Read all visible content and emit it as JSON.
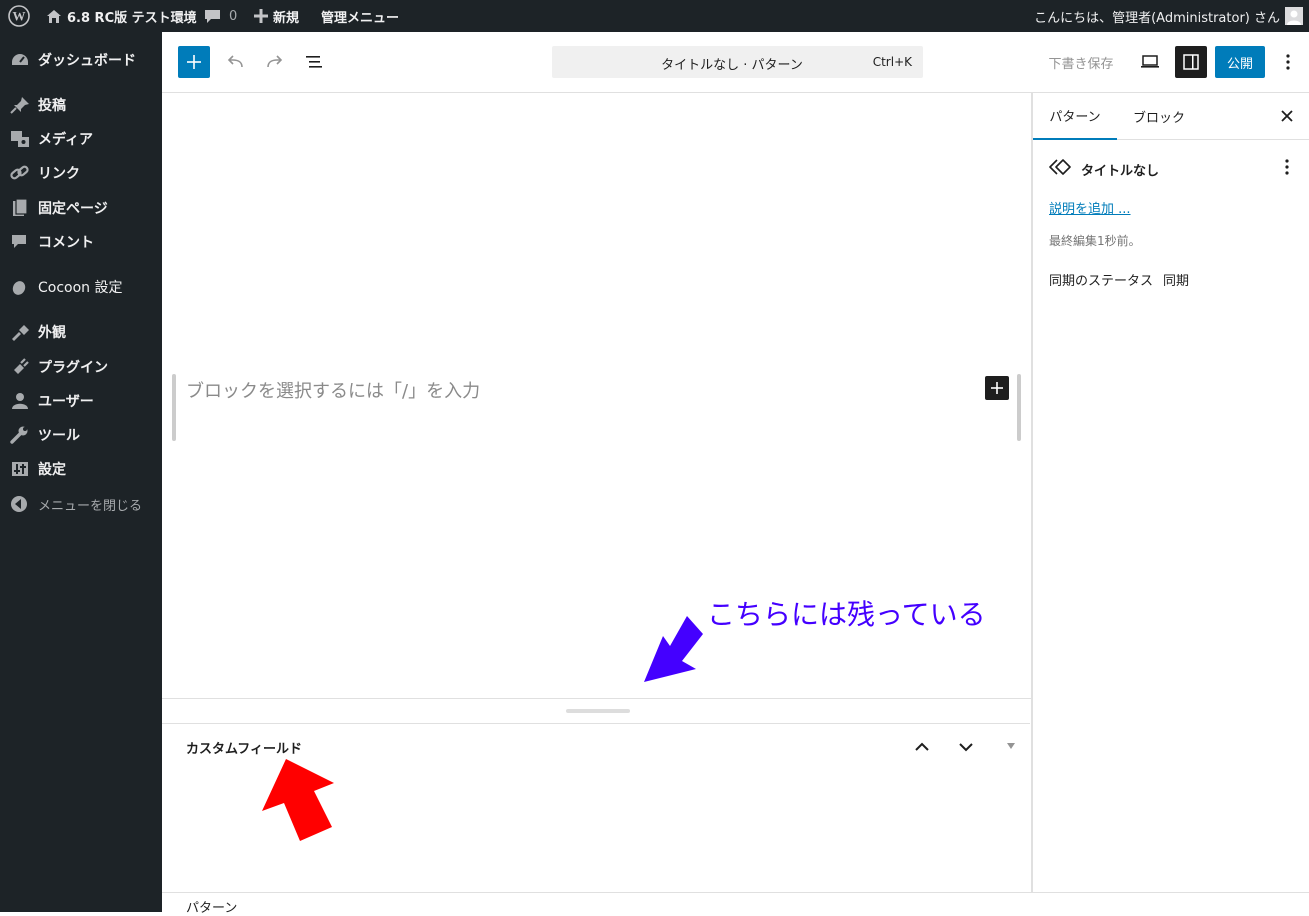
{
  "admin_bar": {
    "site_name": "6.8 RC版 テスト環境",
    "comment_count": "0",
    "new_label": "新規",
    "admin_menu_label": "管理メニュー",
    "greeting": "こんにちは、管理者(Administrator) さん"
  },
  "sidebar": {
    "items": [
      {
        "label": "ダッシュボード",
        "icon": "dashboard-icon"
      },
      {
        "label": "投稿",
        "icon": "pin-icon"
      },
      {
        "label": "メディア",
        "icon": "media-icon"
      },
      {
        "label": "リンク",
        "icon": "link-icon"
      },
      {
        "label": "固定ページ",
        "icon": "page-icon"
      },
      {
        "label": "コメント",
        "icon": "comment-icon"
      },
      {
        "label": "Cocoon 設定",
        "icon": "cocoon-icon"
      },
      {
        "label": "外観",
        "icon": "appearance-icon"
      },
      {
        "label": "プラグイン",
        "icon": "plugin-icon"
      },
      {
        "label": "ユーザー",
        "icon": "user-icon"
      },
      {
        "label": "ツール",
        "icon": "wrench-icon"
      },
      {
        "label": "設定",
        "icon": "settings-icon"
      },
      {
        "label": "メニューを閉じる",
        "icon": "collapse-icon"
      }
    ]
  },
  "toolbar": {
    "doc_title": "タイトルなし · パターン",
    "shortcut": "Ctrl+K",
    "save_draft": "下書き保存",
    "publish": "公開"
  },
  "editor": {
    "placeholder": "ブロックを選択するには「/」を入力",
    "annotation_text": "こちらには残っている",
    "annotation_color": "#4400ff",
    "arrow_red": "#ff0000"
  },
  "panel": {
    "tabs": [
      "パターン",
      "ブロック"
    ],
    "pattern_title": "タイトルなし",
    "add_description": "説明を追加 ...",
    "last_edited": "最終編集1秒前。",
    "sync_status_label": "同期のステータス",
    "sync_status_value": "同期"
  },
  "metabox": {
    "title": "カスタムフィールド"
  },
  "footer": {
    "breadcrumb": "パターン"
  },
  "colors": {
    "admin_bg": "#1d2327",
    "accent": "#007cba",
    "dark_button": "#1e1e1e"
  }
}
